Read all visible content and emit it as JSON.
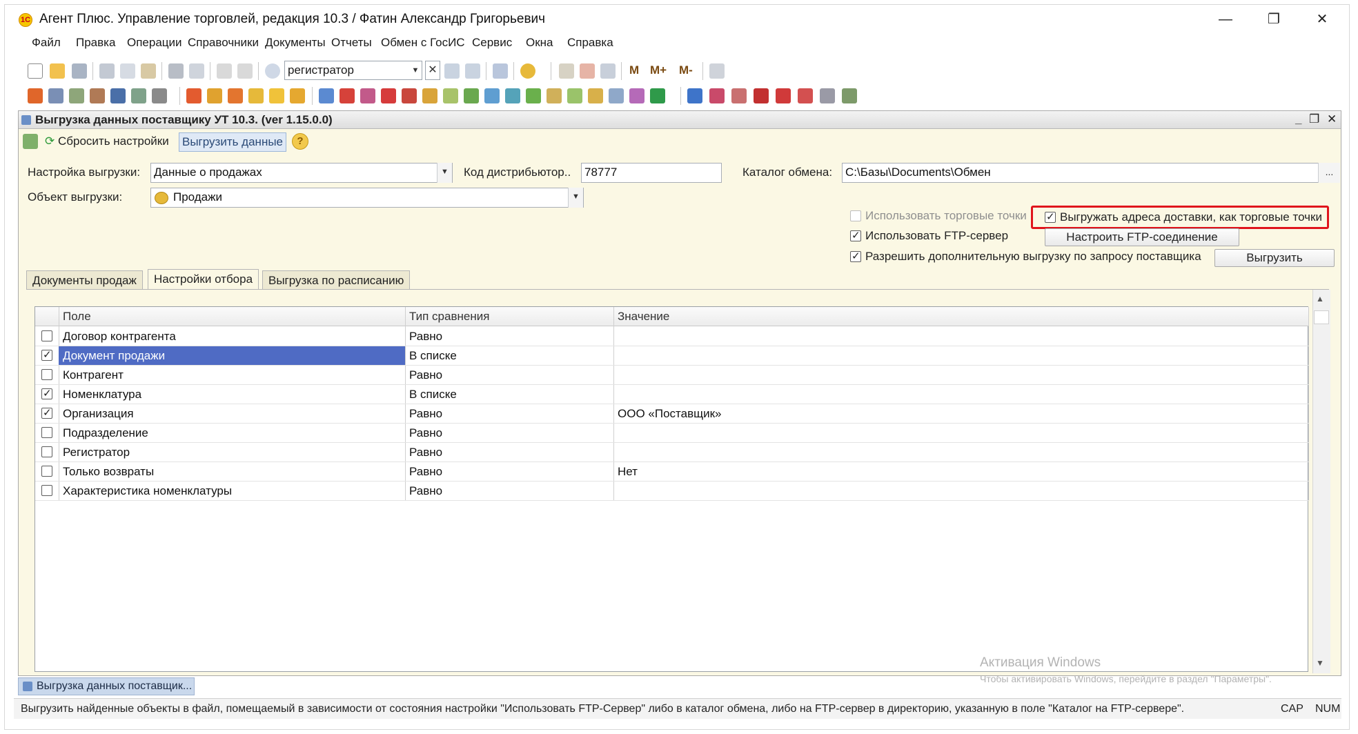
{
  "app": {
    "title": "Агент Плюс. Управление торговлей, редакция 10.3 / Фатин Александр Григорьевич",
    "logo_text": "1С"
  },
  "window_controls": {
    "minimize": "—",
    "restore": "❐",
    "close": "✕"
  },
  "menu": [
    "Файл",
    "Правка",
    "Операции",
    "Справочники",
    "Документы",
    "Отчеты",
    "Обмен с ГосИС",
    "Сервис",
    "Окна",
    "Справка"
  ],
  "toolbar": {
    "search_value": "регистратор",
    "m_buttons": [
      "M",
      "M+",
      "M-"
    ]
  },
  "document": {
    "title": "Выгрузка данных поставщику УТ 10.3. (ver 1.15.0.0)",
    "reset_label": "Сбросить настройки",
    "unload_label": "Выгрузить данные",
    "help_label": "?",
    "controls": {
      "minimize": "_",
      "restore": "❐",
      "close": "✕"
    }
  },
  "form": {
    "settings_label": "Настройка выгрузки:",
    "settings_value": "Данные о продажах",
    "distributor_label": "Код дистрибьютор..",
    "distributor_value": "78777",
    "catalog_label": "Каталог обмена:",
    "catalog_value": "C:\\Базы\\Documents\\Обмен",
    "catalog_btn": "...",
    "object_label": "Объект выгрузки:",
    "object_value": "Продажи"
  },
  "options": {
    "use_trade_points": {
      "label": "Использовать торговые точки",
      "checked": false,
      "disabled": true
    },
    "delivery_addresses": {
      "label": "Выгружать адреса доставки, как торговые точки",
      "checked": true
    },
    "use_ftp": {
      "label": "Использовать FTP-сервер",
      "checked": true
    },
    "ftp_button": "Настроить FTP-соединение",
    "allow_extra": {
      "label": "Разрешить дополнительную выгрузку по запросу поставщика",
      "checked": true
    },
    "unload_button": "Выгрузить"
  },
  "tabs": [
    {
      "label": "Документы продаж",
      "active": false
    },
    {
      "label": "Настройки отбора",
      "active": true
    },
    {
      "label": "Выгрузка по расписанию",
      "active": false
    }
  ],
  "table": {
    "columns": [
      "Поле",
      "Тип сравнения",
      "Значение"
    ],
    "rows": [
      {
        "checked": false,
        "field": "Договор контрагента",
        "compare": "Равно",
        "value": ""
      },
      {
        "checked": true,
        "field": "Документ продажи",
        "compare": "В списке",
        "value": "",
        "selected": true
      },
      {
        "checked": false,
        "field": "Контрагент",
        "compare": "Равно",
        "value": ""
      },
      {
        "checked": true,
        "field": "Номенклатура",
        "compare": "В списке",
        "value": ""
      },
      {
        "checked": true,
        "field": "Организация",
        "compare": "Равно",
        "value": "ООО «Поставщик»"
      },
      {
        "checked": false,
        "field": "Подразделение",
        "compare": "Равно",
        "value": ""
      },
      {
        "checked": false,
        "field": "Регистратор",
        "compare": "Равно",
        "value": ""
      },
      {
        "checked": false,
        "field": "Только возвраты",
        "compare": "Равно",
        "value": "Нет"
      },
      {
        "checked": false,
        "field": "Характеристика номенклатуры",
        "compare": "Равно",
        "value": ""
      }
    ]
  },
  "watermark": {
    "title": "Активация Windows",
    "subtitle": "Чтобы активировать Windows, перейдите в раздел \"Параметры\"."
  },
  "taskbar_tab": "Выгрузка данных поставщик...",
  "status": {
    "text": "Выгрузить найденные объекты в файл, помещаемый в зависимости от состояния настройки \"Использовать FTP-Сервер\" либо в каталог обмена, либо на FTP-сервер в директорию, указанную в поле \"Каталог на FTP-сервере\".",
    "cap": "CAP",
    "num": "NUM"
  },
  "colors": {
    "form_bg": "#fbf8e4",
    "selection": "#4f6bc4",
    "highlight": "#e0141c"
  }
}
